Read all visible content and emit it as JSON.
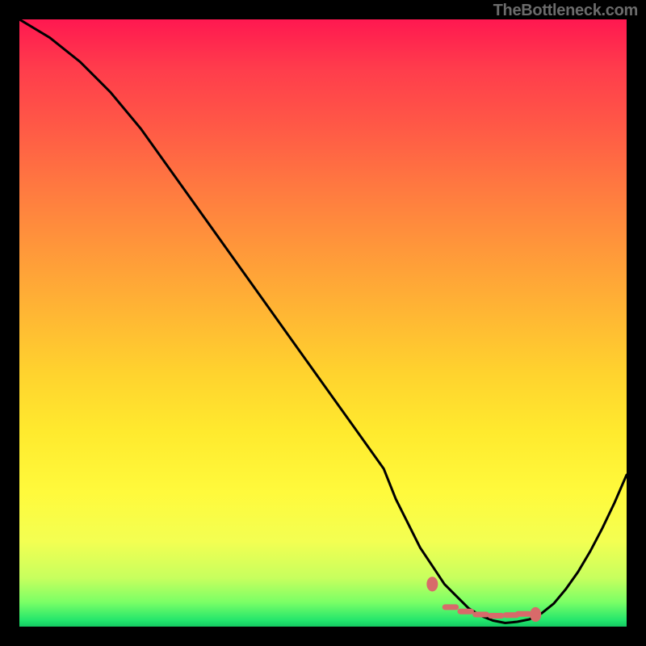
{
  "source_label": "TheBottleneck.com",
  "colors": {
    "curve": "#000000",
    "marker": "#d86a6a",
    "frame": "#000000"
  },
  "chart_data": {
    "type": "line",
    "title": "",
    "xlabel": "",
    "ylabel": "",
    "xlim": [
      0,
      100
    ],
    "ylim": [
      0,
      100
    ],
    "series": [
      {
        "name": "curve",
        "x": [
          0,
          5,
          10,
          15,
          20,
          25,
          30,
          35,
          40,
          45,
          50,
          55,
          60,
          62,
          64,
          66,
          68,
          70,
          72,
          74,
          76,
          78,
          80,
          82,
          84,
          86,
          88,
          90,
          92,
          94,
          96,
          98,
          100
        ],
        "values": [
          100,
          97,
          93,
          88,
          82,
          75,
          68,
          61,
          54,
          47,
          40,
          33,
          26,
          21,
          17,
          13,
          10,
          7,
          5,
          3,
          1.8,
          1.0,
          0.6,
          0.8,
          1.2,
          2.2,
          3.8,
          6.2,
          9.0,
          12.4,
          16.2,
          20.4,
          25
        ]
      }
    ],
    "markers": {
      "name": "minimum-region",
      "left_dot": {
        "x": 68,
        "y": 7
      },
      "right_dot": {
        "x": 85,
        "y": 2
      },
      "dashes_x": [
        71,
        73.5,
        76,
        78.5,
        81,
        83
      ],
      "dashes_y": [
        3.2,
        2.5,
        2.0,
        1.8,
        1.9,
        2.1
      ]
    },
    "gradient_note": "vertical rainbow from red (top) through yellow to green (bottom)"
  }
}
